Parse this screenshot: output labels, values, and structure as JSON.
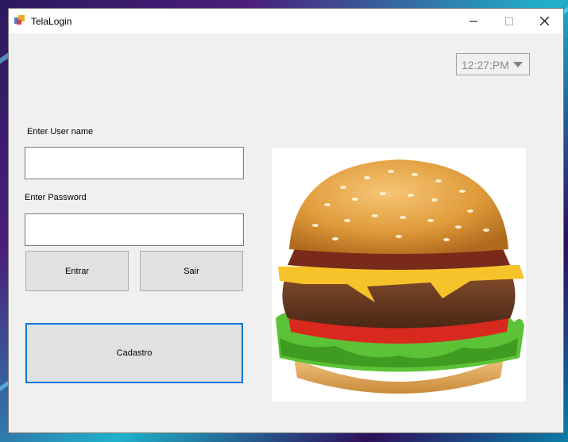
{
  "window": {
    "title": "TelaLogin"
  },
  "clock": {
    "value": "12:27:PM"
  },
  "form": {
    "username_label": "Enter User name",
    "username_value": "",
    "password_label": "Enter Password",
    "password_value": ""
  },
  "buttons": {
    "enter": "Entrar",
    "exit": "Sair",
    "register": "Cadastro"
  },
  "colors": {
    "focus": "#0078d7",
    "bun": "#e3a03d",
    "patty": "#6a3b22",
    "cheese": "#f7c32b",
    "lettuce": "#5cc236",
    "tomato": "#d9281e"
  },
  "icons": [
    "app-icon",
    "minimize-icon",
    "maximize-icon",
    "close-icon",
    "dropdown-arrow-icon"
  ]
}
